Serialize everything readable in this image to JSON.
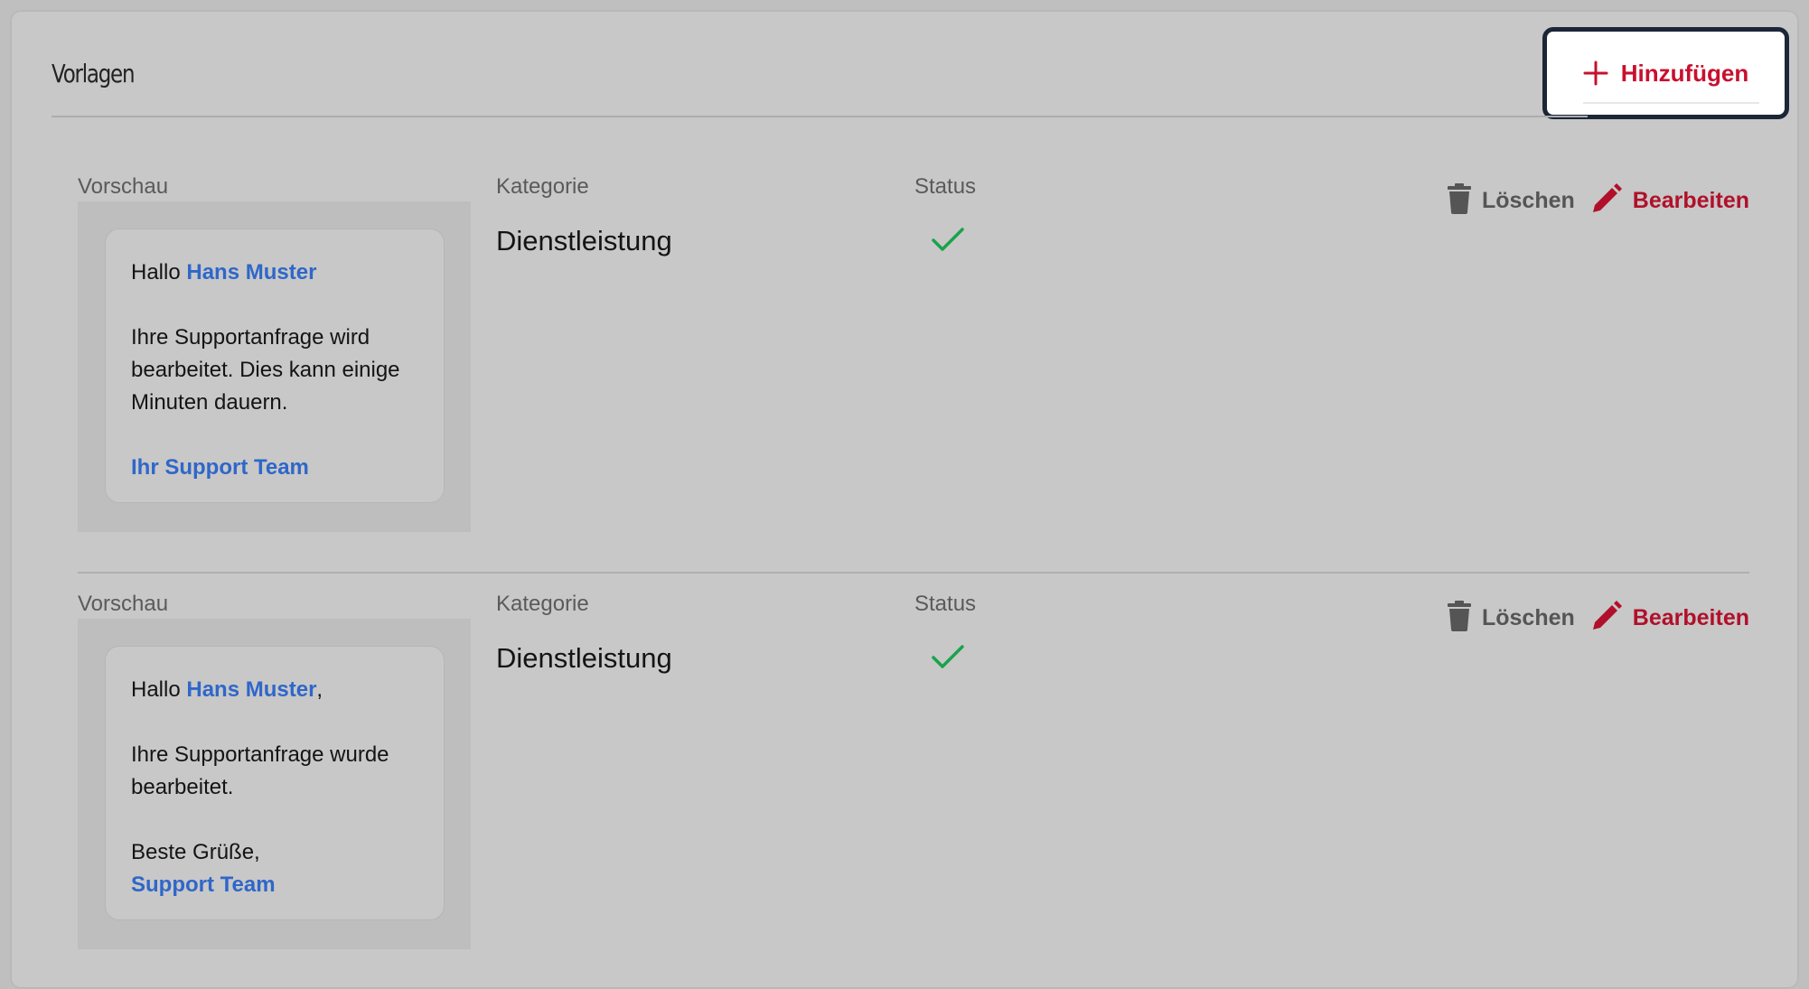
{
  "header": {
    "title": "Vorlagen",
    "add_label": "Hinzufügen"
  },
  "columns": {
    "preview": "Vorschau",
    "category": "Kategorie",
    "status": "Status"
  },
  "actions": {
    "delete_label": "Löschen",
    "edit_label": "Bearbeiten"
  },
  "templates": [
    {
      "greeting": "Hallo",
      "recipient": "Hans Muster",
      "greeting_suffix": "",
      "body": "Ihre Supportanfrage wird bearbeitet. Dies kann einige Minuten dauern.",
      "closing": "",
      "signature": "Ihr Support Team",
      "category": "Dienstleistung",
      "status": "active"
    },
    {
      "greeting": "Hallo",
      "recipient": "Hans Muster",
      "greeting_suffix": ",",
      "body": "Ihre Supportanfrage wurde bearbeitet.",
      "closing": "Beste Grüße,",
      "signature": "Support Team",
      "category": "Dienstleistung",
      "status": "active"
    }
  ],
  "colors": {
    "accent": "#c8102e",
    "highlight": "#2f67c9",
    "status_ok": "#1aa34a",
    "delete": "#555555"
  },
  "icons": {
    "add": "plus-icon",
    "delete": "trash-icon",
    "edit": "pencil-icon",
    "status": "check-icon"
  }
}
